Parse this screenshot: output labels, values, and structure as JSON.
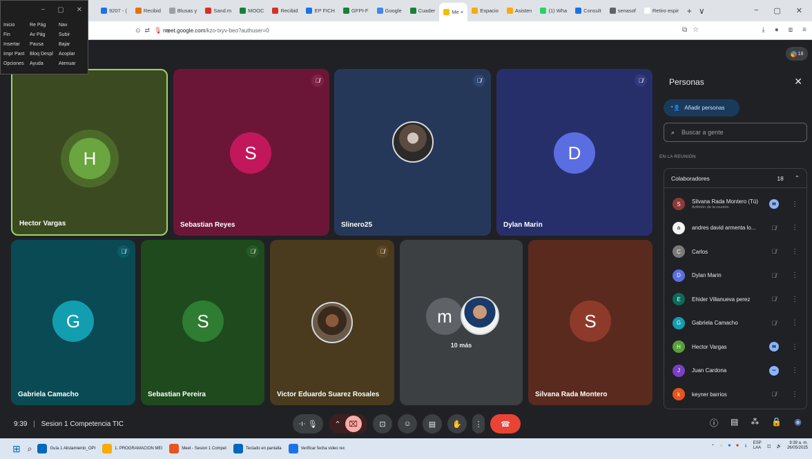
{
  "browser": {
    "tabs": [
      {
        "label": "9207 - (",
        "color": "#1a73e8"
      },
      {
        "label": "Recibid",
        "color": "#e37400"
      },
      {
        "label": "Blusas y",
        "color": "#9aa0a6"
      },
      {
        "label": "Sand.m",
        "color": "#d93025"
      },
      {
        "label": "MOOC",
        "color": "#188038"
      },
      {
        "label": "Recibid",
        "color": "#d93025"
      },
      {
        "label": "EP FICH",
        "color": "#1a73e8"
      },
      {
        "label": "GFPI-F",
        "color": "#188038"
      },
      {
        "label": "Google",
        "color": "#4285f4"
      },
      {
        "label": "Cuader",
        "color": "#188038"
      },
      {
        "label": "Me ×",
        "color": "#fbbc04"
      },
      {
        "label": "Espacio",
        "color": "#f9ab00"
      },
      {
        "label": "Asisten",
        "color": "#f9ab00"
      },
      {
        "label": "(1) Wha",
        "color": "#25d366"
      },
      {
        "label": "Consult",
        "color": "#1a73e8"
      },
      {
        "label": "senasof",
        "color": "#5f6368"
      },
      {
        "label": "Retiro espir",
        "color": "#ffffff"
      }
    ],
    "new_tab": "+",
    "tab_menu": "∨",
    "win_min": "−",
    "win_restore": "▢",
    "win_close": "✕",
    "url_domain": "meet.google.com",
    "url_path": "/kzo-txyv-beo?authuser=0"
  },
  "osk": {
    "keys": [
      "Inicio",
      "Re Pág",
      "Nav",
      "Fin",
      "Av Pág",
      "Subir",
      "Insertar",
      "Pausa",
      "Bajar",
      "Impr Pant",
      "Bloq Despl",
      "Acoplar",
      "Opciones",
      "Ayuda",
      "Atenuar"
    ],
    "bar_min": "−",
    "bar_max": "▢",
    "bar_close": "✕"
  },
  "meet": {
    "people_count": "18",
    "tiles": [
      {
        "name": "Hector Vargas",
        "initial": "H"
      },
      {
        "name": "Sebastian Reyes",
        "initial": "S"
      },
      {
        "name": "Slinero25",
        "initial": ""
      },
      {
        "name": "Dylan Marin",
        "initial": "D"
      },
      {
        "name": "Gabriela Camacho",
        "initial": "G"
      },
      {
        "name": "Sebastian Pereira",
        "initial": "S"
      },
      {
        "name": "Victor Eduardo Suarez Rosales",
        "initial": ""
      },
      {
        "name": "10 más",
        "initial": "m"
      },
      {
        "name": "Silvana Rada Montero",
        "initial": "S"
      }
    ]
  },
  "panel": {
    "title": "Personas",
    "add_label": "Añadir personas",
    "search_placeholder": "Buscar a gente",
    "section": "EN LA REUNIÓN",
    "group": "Colaboradores",
    "group_count": "18",
    "participants": [
      {
        "name": "Silvana Rada Montero (Tú)",
        "sub": "Anfitrión de la reunión",
        "initial": "S",
        "color": "#8e3a3a",
        "status": "talk"
      },
      {
        "name": "andres david armenta lo...",
        "sub": "",
        "initial": "a",
        "color": "#f1f3f4",
        "status": "muted"
      },
      {
        "name": "Carlos",
        "sub": "",
        "initial": "C",
        "color": "#7b7b7b",
        "status": "muted"
      },
      {
        "name": "Dylan Marin",
        "sub": "",
        "initial": "D",
        "color": "#5b6ee1",
        "status": "muted"
      },
      {
        "name": "Ehider Villanueva perez",
        "sub": "",
        "initial": "E",
        "color": "#0b6b5b",
        "status": "muted"
      },
      {
        "name": "Gabriela Camacho",
        "sub": "",
        "initial": "G",
        "color": "#129eaf",
        "status": "muted"
      },
      {
        "name": "Hector Vargas",
        "sub": "",
        "initial": "H",
        "color": "#5a9e3a",
        "status": "talk"
      },
      {
        "name": "Juan Cardona",
        "sub": "",
        "initial": "J",
        "color": "#7b3fc4",
        "status": "dots"
      },
      {
        "name": "keyner barrios",
        "sub": "",
        "initial": "k",
        "color": "#e8531e",
        "status": "muted"
      }
    ]
  },
  "bottom": {
    "time": "9:39",
    "separator": "|",
    "meeting": "Sesion 1 Competencia TIC"
  },
  "taskbar": {
    "items": [
      "Guía 1 Alistamiento_OPI",
      "1. PROGRAMACION MEI",
      "Meet - Sesion 1 Compet",
      "Teclado en pantalla",
      "Verificar fecha video rec"
    ],
    "lang": "ESP",
    "lang2": "LAA",
    "time": "9:39 a. m.",
    "date": "26/05/2025"
  }
}
